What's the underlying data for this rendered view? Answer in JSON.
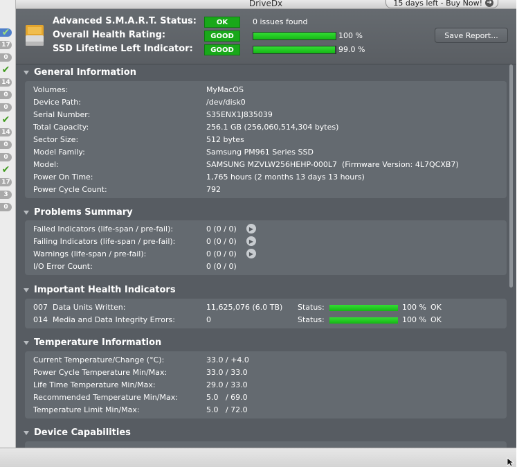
{
  "window": {
    "title": "DriveDx",
    "buy_label": "15 days left - Buy Now!"
  },
  "sidebar": {
    "items": [
      {
        "kind": "check",
        "text": "✔",
        "selected": true
      },
      {
        "kind": "badge",
        "text": "17"
      },
      {
        "kind": "badge",
        "text": "0"
      },
      {
        "kind": "check",
        "text": "✔"
      },
      {
        "kind": "badge",
        "text": "14"
      },
      {
        "kind": "badge",
        "text": "0"
      },
      {
        "kind": "badge",
        "text": "0"
      },
      {
        "kind": "check",
        "text": "✔"
      },
      {
        "kind": "badge",
        "text": "14"
      },
      {
        "kind": "badge",
        "text": "0"
      },
      {
        "kind": "badge",
        "text": "0"
      },
      {
        "kind": "check",
        "text": "✔"
      },
      {
        "kind": "badge",
        "text": "17"
      },
      {
        "kind": "badge",
        "text": "3"
      },
      {
        "kind": "badge",
        "text": "0"
      }
    ]
  },
  "header": {
    "smart_label": "Advanced S.M.A.R.T. Status:",
    "smart_badge": "OK",
    "smart_text": "0 issues found",
    "health_label": "Overall Health Rating:",
    "health_badge": "GOOD",
    "health_pct": "100 %",
    "health_value": 1.0,
    "ssd_label": "SSD Lifetime Left Indicator:",
    "ssd_badge": "GOOD",
    "ssd_pct": "99.0 %",
    "ssd_value": 0.99,
    "save_label": "Save Report...",
    "badge_color": "#19a81a"
  },
  "general": {
    "title": "General Information",
    "rows": [
      {
        "label": "Volumes:",
        "value": "MyMacOS"
      },
      {
        "label": "Device Path:",
        "value": "/dev/disk0"
      },
      {
        "label": "Serial Number:",
        "value": "S35ENX1J835039"
      },
      {
        "label": "Total Capacity:",
        "value": "256.1 GB (256,060,514,304 bytes)"
      },
      {
        "label": "Sector Size:",
        "value": "512 bytes"
      },
      {
        "label": "Model Family:",
        "value": "Samsung PM961 Series SSD"
      },
      {
        "label": "Model:",
        "value": "SAMSUNG MZVLW256HEHP-000L7  (Firmware Version: 4L7QCXB7)"
      },
      {
        "label": "Power On Time:",
        "value": "1,765 hours (2 months 13 days 13 hours)"
      },
      {
        "label": "Power Cycle Count:",
        "value": "792"
      }
    ]
  },
  "problems": {
    "title": "Problems Summary",
    "rows": [
      {
        "label": "Failed Indicators (life-span / pre-fail):",
        "value": "0 (0 / 0)",
        "has_arrow": true
      },
      {
        "label": "Failing Indicators (life-span / pre-fail):",
        "value": "0 (0 / 0)",
        "has_arrow": true
      },
      {
        "label": "Warnings (life-span / pre-fail):",
        "value": "0 (0 / 0)",
        "has_arrow": true
      },
      {
        "label": "I/O Error Count:",
        "value": "0 (0 / 0)",
        "has_arrow": false
      }
    ]
  },
  "health": {
    "title": "Important Health Indicators",
    "rows": [
      {
        "label": "007  Data Units Written:",
        "value": "11,625,076 (6.0 TB)",
        "status_label": "Status:",
        "pct": "100 %",
        "level": 1.0,
        "state": "OK"
      },
      {
        "label": "014  Media and Data Integrity Errors:",
        "value": "0",
        "status_label": "Status:",
        "pct": "100 %",
        "level": 1.0,
        "state": "OK"
      }
    ]
  },
  "temperature": {
    "title": "Temperature Information",
    "rows": [
      {
        "label": "Current Temperature/Change (°C):",
        "value": "33.0 / +4.0"
      },
      {
        "label": "Power Cycle Temperature Min/Max:",
        "value": "33.0 / 33.0"
      },
      {
        "label": "Life Time Temperature Min/Max:",
        "value": "29.0 / 33.0"
      },
      {
        "label": "Recommended Temperature Min/Max:",
        "value": "5.0   / 69.0"
      },
      {
        "label": "Temperature Limit Min/Max:",
        "value": "5.0   / 72.0"
      }
    ]
  },
  "capabilities": {
    "title": "Device Capabilities"
  }
}
